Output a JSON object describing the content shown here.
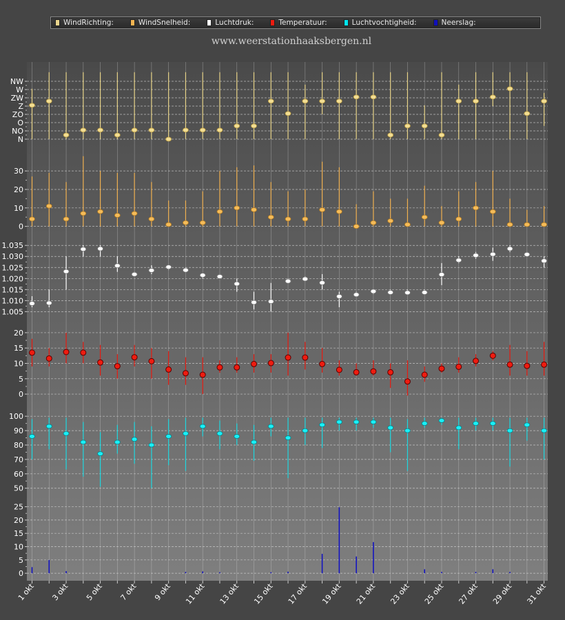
{
  "site_title": "www.weerstationhaaksbergen.nl",
  "legend": [
    {
      "label": "WindRichting:",
      "color": "#e9d48c"
    },
    {
      "label": "WindSnelheid:",
      "color": "#f2b452"
    },
    {
      "label": "Luchtdruk:",
      "color": "#ffffff"
    },
    {
      "label": "Temperatuur:",
      "color": "#ee1c10"
    },
    {
      "label": "Luchtvochtigheid:",
      "color": "#00e4ee"
    },
    {
      "label": "Neerslag:",
      "color": "#1010bb"
    }
  ],
  "colors": {
    "background": "#454545",
    "grid": "#dedede"
  },
  "chart_data": {
    "type": "range_dot",
    "x": [
      "1 okt",
      "2 okt",
      "3 okt",
      "4 okt",
      "5 okt",
      "6 okt",
      "7 okt",
      "8 okt",
      "9 okt",
      "10 okt",
      "11 okt",
      "12 okt",
      "13 okt",
      "14 okt",
      "15 okt",
      "16 okt",
      "17 okt",
      "18 okt",
      "19 okt",
      "20 okt",
      "21 okt",
      "22 okt",
      "23 okt",
      "24 okt",
      "25 okt",
      "26 okt",
      "27 okt",
      "28 okt",
      "29 okt",
      "30 okt",
      "31 okt"
    ],
    "x_tick_labels": [
      "1 okt",
      "3 okt",
      "5 okt",
      "7 okt",
      "9 okt",
      "11 okt",
      "13 okt",
      "15 okt",
      "17 okt",
      "19 okt",
      "21 okt",
      "23 okt",
      "25 okt",
      "27 okt",
      "29 okt",
      "31 okt"
    ],
    "grid": true,
    "legend_position": "top",
    "panels": [
      {
        "name": "WindRichting",
        "ticks": [
          0,
          1,
          2,
          3,
          4,
          5,
          6,
          7
        ],
        "tick_labels": [
          "N",
          "NO",
          "O",
          "ZO",
          "Z",
          "ZW",
          "W",
          "NW"
        ],
        "ylim": [
          -0.5,
          8.5
        ],
        "values": [
          4.1,
          4.6,
          0.5,
          1.1,
          1.1,
          0.5,
          1.1,
          1.1,
          0.0,
          1.1,
          1.1,
          1.1,
          1.6,
          1.6,
          4.6,
          3.1,
          4.6,
          4.6,
          4.6,
          5.1,
          5.1,
          0.5,
          1.6,
          1.6,
          0.5,
          4.6,
          4.6,
          5.1,
          6.1,
          3.1,
          4.6
        ],
        "low": [
          0,
          0,
          0,
          0,
          0,
          0,
          0,
          0,
          0,
          0,
          0,
          0,
          0,
          0,
          0,
          0,
          0,
          3,
          0,
          0,
          0,
          0,
          0,
          0,
          0,
          0,
          0,
          4,
          0,
          0,
          1.6
        ],
        "high": [
          6.1,
          8.1,
          8.1,
          8.1,
          8.1,
          8.1,
          8.1,
          8.1,
          8.1,
          8.1,
          8.1,
          8.1,
          8.1,
          8.1,
          8.1,
          8.1,
          6.6,
          8.1,
          8.1,
          8.1,
          8.1,
          8.1,
          8.1,
          4.1,
          8.1,
          6.6,
          8.1,
          8.1,
          8.1,
          8.1,
          5.6
        ]
      },
      {
        "name": "WindSnelheid",
        "ticks": [
          0,
          10,
          20,
          30
        ],
        "tick_labels": [
          "0",
          "10",
          "20",
          "30"
        ],
        "ylim": [
          -2,
          39
        ],
        "values": [
          4,
          11,
          4,
          7,
          8,
          6,
          7,
          4,
          1,
          2,
          2,
          8,
          10,
          9,
          5,
          4,
          4,
          9,
          8,
          0,
          2,
          3,
          1,
          5,
          2,
          4,
          10,
          8,
          1,
          1,
          1
        ],
        "low": [
          0,
          0,
          0,
          0,
          0,
          0,
          0,
          0,
          0,
          0,
          0,
          0,
          0,
          0,
          0,
          0,
          0,
          0,
          0,
          0,
          0,
          0,
          0,
          0,
          0,
          0,
          0,
          0,
          0,
          0,
          0
        ],
        "high": [
          27,
          29,
          24,
          38,
          30,
          29,
          29,
          24,
          14,
          14,
          19,
          30,
          32,
          33,
          24,
          19,
          20,
          35,
          32,
          12,
          19,
          15,
          15,
          22,
          11,
          19,
          24,
          30,
          15,
          9,
          11
        ]
      },
      {
        "name": "Luchtdruk",
        "ticks": [
          1.005,
          1.01,
          1.015,
          1.02,
          1.025,
          1.03,
          1.035
        ],
        "tick_labels": [
          "1.005",
          "1.010",
          "1.015",
          "1.020",
          "1.025",
          "1.030",
          "1.035"
        ],
        "ylim": [
          1.002,
          1.0385
        ],
        "values": [
          1.0087,
          1.0089,
          1.0232,
          1.0333,
          1.0335,
          1.0258,
          1.0219,
          1.0237,
          1.0252,
          1.0238,
          1.0215,
          1.0209,
          1.0176,
          1.0092,
          1.0096,
          1.0188,
          1.0198,
          1.0181,
          1.0119,
          1.0127,
          1.0142,
          1.0137,
          1.0136,
          1.0137,
          1.0218,
          1.0283,
          1.0305,
          1.031,
          1.0335,
          1.0309,
          1.028
        ],
        "low": [
          1.007,
          1.007,
          1.015,
          1.03,
          1.03,
          1.023,
          1.021,
          1.022,
          1.024,
          1.023,
          1.02,
          1.02,
          1.014,
          1.006,
          1.005,
          1.018,
          1.019,
          1.015,
          1.007,
          1.012,
          1.013,
          1.013,
          1.013,
          1.013,
          1.017,
          1.027,
          1.029,
          1.028,
          1.032,
          1.03,
          1.025
        ],
        "high": [
          1.012,
          1.015,
          1.03,
          1.035,
          1.035,
          1.03,
          1.023,
          1.026,
          1.026,
          1.025,
          1.022,
          1.022,
          1.02,
          1.014,
          1.018,
          1.02,
          1.021,
          1.022,
          1.014,
          1.014,
          1.015,
          1.015,
          1.015,
          1.015,
          1.027,
          1.03,
          1.032,
          1.034,
          1.035,
          1.032,
          1.03
        ]
      },
      {
        "name": "Temperatuur",
        "ticks": [
          0,
          5,
          10,
          15,
          20
        ],
        "tick_labels": [
          "0",
          "5",
          "10",
          "15",
          "20"
        ],
        "ylim": [
          -2,
          22
        ],
        "values": [
          13.5,
          11.6,
          13.7,
          13.5,
          10.3,
          9.1,
          12.0,
          10.7,
          8.0,
          6.8,
          6.3,
          8.7,
          8.7,
          9.8,
          10.1,
          11.9,
          11.9,
          9.8,
          7.9,
          7.1,
          7.4,
          7.1,
          4.1,
          6.3,
          8.3,
          8.9,
          10.8,
          12.5,
          9.6,
          9.2,
          9.6
        ],
        "low": [
          9,
          9,
          10,
          10,
          6,
          5,
          9,
          5,
          3,
          3,
          0,
          7,
          7,
          7,
          7,
          6,
          8,
          7,
          6,
          6,
          6,
          2,
          -0.5,
          4,
          7,
          7,
          9,
          11,
          6,
          6,
          6
        ],
        "high": [
          18,
          15,
          20,
          17,
          16,
          13,
          16,
          15,
          14,
          12,
          12,
          11,
          12,
          13,
          13,
          20,
          17,
          15,
          11,
          10,
          11,
          10,
          11,
          9,
          10,
          12,
          13,
          14,
          16,
          14,
          17
        ]
      },
      {
        "name": "Luchtvochtigheid",
        "ticks": [
          50,
          60,
          70,
          80,
          90,
          100
        ],
        "tick_labels": [
          "50",
          "60",
          "70",
          "80",
          "90",
          "100"
        ],
        "ylim": [
          47,
          102
        ],
        "values": [
          86,
          93,
          88,
          82,
          74,
          82,
          84,
          80,
          86,
          88,
          93,
          88,
          86,
          82,
          93,
          85,
          90,
          94,
          96,
          96,
          96,
          92,
          90,
          95,
          97,
          92,
          95,
          95,
          90,
          94,
          90
        ],
        "low": [
          70,
          77,
          63,
          58,
          51,
          74,
          67,
          50,
          66,
          62,
          86,
          77,
          80,
          69,
          86,
          57,
          80,
          78,
          90,
          90,
          92,
          75,
          62,
          92,
          94,
          77,
          90,
          90,
          65,
          83,
          70
        ],
        "high": [
          98,
          99,
          99,
          96,
          89,
          94,
          96,
          93,
          98,
          99,
          99,
          97,
          95,
          94,
          99,
          99,
          99,
          99,
          99,
          99,
          99,
          99,
          98,
          99,
          99,
          99,
          99,
          99,
          99,
          99,
          99
        ]
      },
      {
        "name": "Neerslag",
        "ticks": [
          0,
          5,
          10,
          15,
          20,
          25
        ],
        "tick_labels": [
          "0",
          "5",
          "10",
          "15",
          "20",
          "25"
        ],
        "ylim": [
          -1,
          28
        ],
        "values": [
          2.3,
          5.0,
          0.8,
          0,
          0,
          0,
          0,
          0,
          0,
          0.5,
          0.7,
          0.4,
          0,
          0,
          0.4,
          0.6,
          0,
          7.3,
          24.8,
          6.3,
          11.7,
          0,
          0,
          1.5,
          0.5,
          0,
          0.5,
          1.5,
          0.5,
          0,
          0
        ]
      }
    ]
  }
}
